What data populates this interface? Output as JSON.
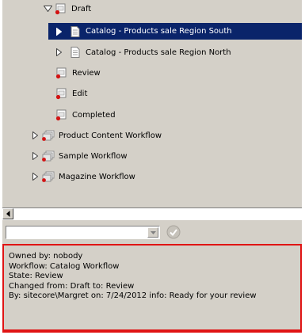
{
  "tree": {
    "items": [
      {
        "label": "Draft",
        "expander": "expanded",
        "icon": "state-icon",
        "selected": false
      },
      {
        "label": "Catalog - Products sale Region South",
        "expander": "collapsed",
        "icon": "document-icon",
        "selected": true
      },
      {
        "label": "Catalog - Products sale Region North",
        "expander": "collapsed",
        "icon": "document-icon",
        "selected": false
      },
      {
        "label": "Review",
        "expander": "none",
        "icon": "state-icon",
        "selected": false
      },
      {
        "label": "Edit",
        "expander": "none",
        "icon": "state-icon",
        "selected": false
      },
      {
        "label": "Completed",
        "expander": "none",
        "icon": "state-icon",
        "selected": false
      },
      {
        "label": "Product Content Workflow",
        "expander": "collapsed",
        "icon": "workflow-icon",
        "selected": false
      },
      {
        "label": "Sample Workflow",
        "expander": "collapsed",
        "icon": "workflow-icon",
        "selected": false
      },
      {
        "label": "Magazine Workflow",
        "expander": "collapsed",
        "icon": "workflow-icon",
        "selected": false
      }
    ]
  },
  "toolbar": {
    "combo_value": "",
    "ok_icon": "checkmark-circle-icon"
  },
  "info": {
    "owned_by": "Owned by: nobody",
    "workflow": "Workflow: Catalog Workflow",
    "state": "State: Review",
    "changed_from": "Changed from: Draft to: Review",
    "by": "By: sitecore\\Margret on: 7/24/2012 info: Ready for your review"
  },
  "colors": {
    "panel_bg": "#d4d0c8",
    "selection_bg": "#0a246a",
    "highlight_border": "#e01414"
  }
}
